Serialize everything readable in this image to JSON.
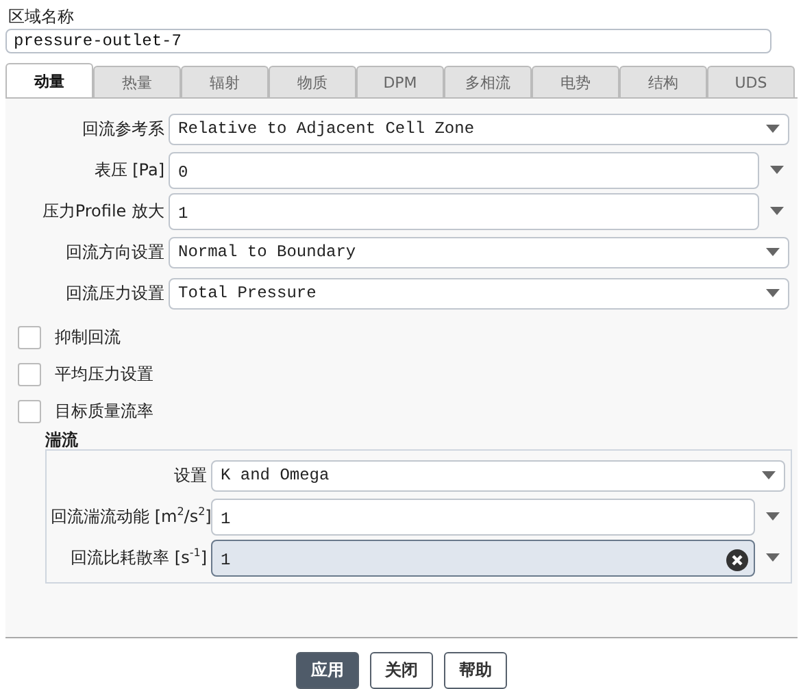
{
  "zone_name": {
    "label": "区域名称",
    "value": "pressure-outlet-7"
  },
  "tabs": [
    {
      "label": "动量",
      "selected": true
    },
    {
      "label": "热量",
      "selected": false
    },
    {
      "label": "辐射",
      "selected": false
    },
    {
      "label": "物质",
      "selected": false
    },
    {
      "label": "DPM",
      "selected": false
    },
    {
      "label": "多相流",
      "selected": false
    },
    {
      "label": "电势",
      "selected": false
    },
    {
      "label": "结构",
      "selected": false
    },
    {
      "label": "UDS",
      "selected": false
    }
  ],
  "fields": [
    {
      "kind": "select",
      "label": "回流参考系",
      "value": "Relative to Adjacent Cell Zone"
    },
    {
      "kind": "input",
      "label": "表压 [Pa]",
      "value": "0",
      "focused": false
    },
    {
      "kind": "input",
      "label": "压力Profile 放大",
      "value": "1",
      "focused": false
    },
    {
      "kind": "select",
      "label": "回流方向设置",
      "value": "Normal to Boundary"
    },
    {
      "kind": "select",
      "label": "回流压力设置",
      "value": "Total Pressure"
    }
  ],
  "checkboxes": [
    {
      "label": "抑制回流",
      "checked": false
    },
    {
      "label": "平均压力设置",
      "checked": false
    },
    {
      "label": "目标质量流率",
      "checked": false
    }
  ],
  "turbulence": {
    "title": "湍流",
    "fields": [
      {
        "kind": "select",
        "label": "设置",
        "value": "K and Omega"
      },
      {
        "kind": "input",
        "label": "回流湍流动能 [m$^{2}$/s$^{2}$]",
        "value": "1",
        "focused": false
      },
      {
        "kind": "input",
        "label": "回流比耗散率 [s$^{-1}$]",
        "value": "1",
        "focused": true
      }
    ]
  },
  "buttons": [
    {
      "label": "应用",
      "primary": true
    },
    {
      "label": "关闭",
      "primary": false
    },
    {
      "label": "帮助",
      "primary": false
    }
  ]
}
